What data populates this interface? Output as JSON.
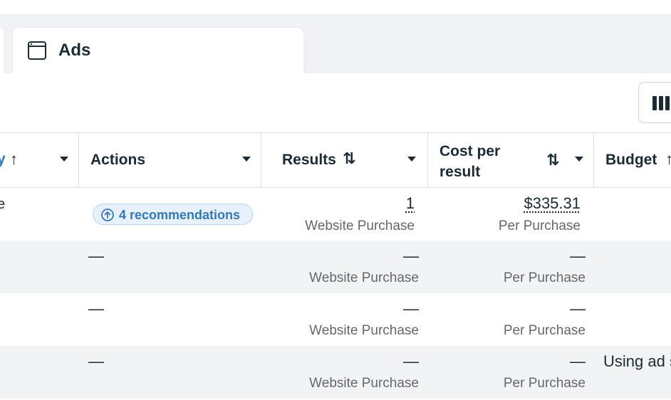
{
  "tabs": {
    "ads_label": "Ads"
  },
  "table": {
    "headers": {
      "first_partial": "y",
      "actions": "Actions",
      "results": "Results",
      "cost_per_result_line1": "Cost per",
      "cost_per_result_line2": "result",
      "budget": "Budget"
    },
    "rows": [
      {
        "first_partial": "e",
        "recommendation": "4 recommendations",
        "results_value": "1",
        "results_sub": "Website Purchase",
        "cost_value": "$335.31",
        "cost_sub": "Per Purchase",
        "budget": ""
      },
      {
        "actions": "—",
        "results_value": "—",
        "results_sub": "Website Purchase",
        "cost_value": "—",
        "cost_sub": "Per Purchase",
        "budget": ""
      },
      {
        "actions": "—",
        "results_value": "—",
        "results_sub": "Website Purchase",
        "cost_value": "—",
        "cost_sub": "Per Purchase",
        "budget": ""
      },
      {
        "actions": "—",
        "results_value": "—",
        "results_sub": "Website Purchase",
        "cost_value": "—",
        "cost_sub": "Per Purchase",
        "budget": "Using ad s"
      }
    ]
  },
  "colors": {
    "accent": "#3578b7",
    "text": "#1c2b33",
    "muted": "#65676b",
    "tab_strip_bg": "#f0f2f5",
    "row_alt_bg": "#f2f3f5"
  },
  "icons": {
    "ads_tab": "ad-frame-icon",
    "columns": "columns-icon",
    "recommendation": "arrow-up-circle-icon",
    "sort": "sort-arrows-icon",
    "dropdown": "caret-down-icon"
  }
}
